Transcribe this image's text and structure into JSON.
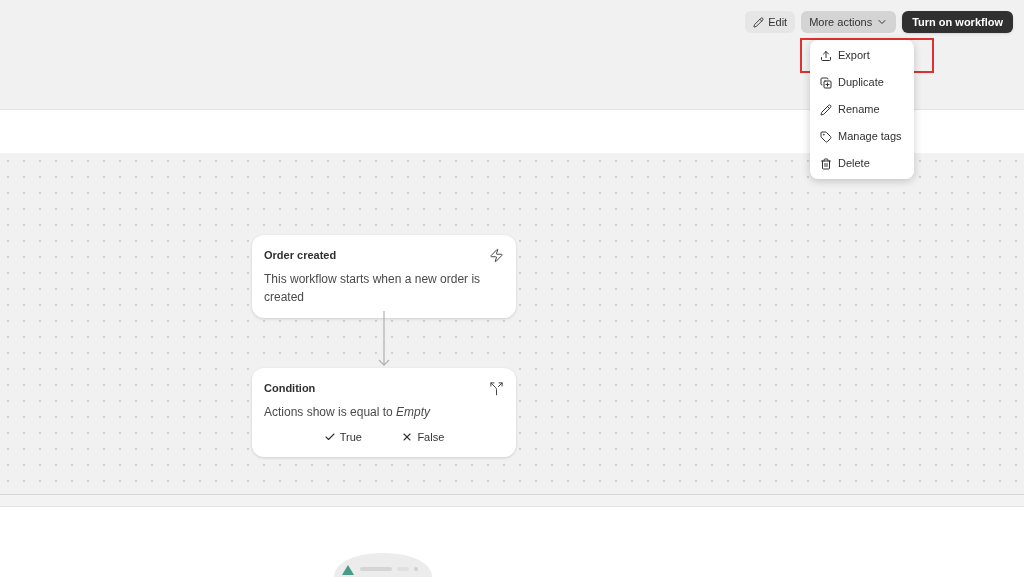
{
  "toolbar": {
    "edit_button": "Edit",
    "more_actions_button": "More actions",
    "primary_button": "Turn on workflow"
  },
  "menu": {
    "items": [
      {
        "label": "Export",
        "kind": "export",
        "highlighted": true
      },
      {
        "label": "Duplicate",
        "kind": "duplicate",
        "highlighted": false
      },
      {
        "label": "Rename",
        "kind": "rename",
        "highlighted": false
      },
      {
        "label": "Manage tags",
        "kind": "tags",
        "highlighted": false
      },
      {
        "label": "Delete",
        "kind": "delete",
        "highlighted": false
      }
    ]
  },
  "nodes": [
    {
      "kind": "trigger",
      "title": "Order created",
      "description": "This workflow starts when a new order is created"
    },
    {
      "kind": "condition",
      "title": "Condition",
      "description": "Actions show is equal to *Empty*",
      "branches": [
        "True",
        "False"
      ]
    }
  ]
}
